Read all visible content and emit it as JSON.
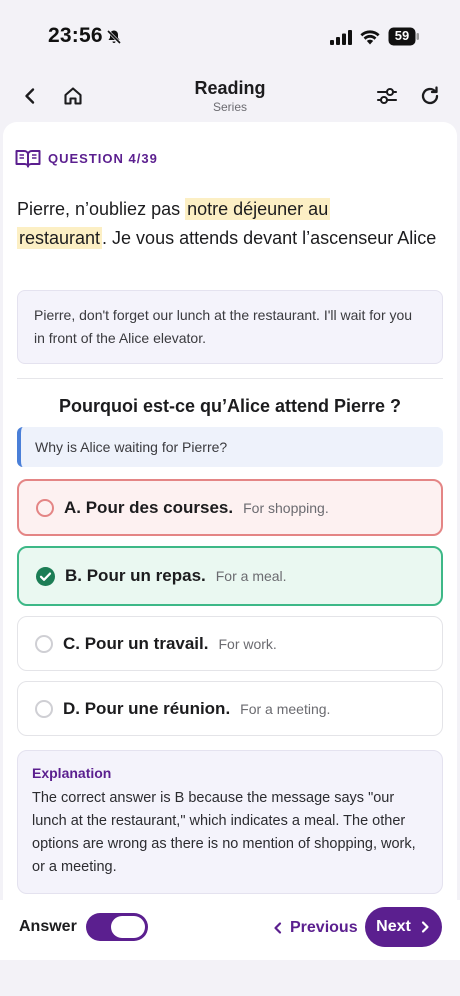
{
  "status": {
    "time": "23:56",
    "battery": "59"
  },
  "header": {
    "title": "Reading",
    "subtitle": "Series"
  },
  "question_badge": {
    "label": "QUESTION 4/39"
  },
  "passage": {
    "before": "Pierre, n’oubliez pas ",
    "highlight_1": "notre déjeuner au",
    "highlight_2": "restaurant",
    "after": ". Je vous attends devant l’ascenseur Alice"
  },
  "passage_translation": "Pierre, don't forget our lunch at the restaurant. I'll wait for you in front of the Alice elevator.",
  "question": {
    "text": "Pourquoi est-ce qu’Alice attend Pierre ?",
    "translation": "Why is Alice waiting for Pierre?"
  },
  "options": [
    {
      "label": "A. Pour des courses.",
      "translation": "For shopping.",
      "state": "wrong"
    },
    {
      "label": "B. Pour un repas.",
      "translation": "For a meal.",
      "state": "correct"
    },
    {
      "label": "C. Pour un travail.",
      "translation": "For work.",
      "state": "neutral"
    },
    {
      "label": "D. Pour une réunion.",
      "translation": "For a meeting.",
      "state": "neutral"
    }
  ],
  "explanation": {
    "title": "Explanation",
    "body": "The correct answer is B because the message says \"our lunch at the restaurant,\" which indicates a meal. The other options are wrong as there is no mention of shopping, work, or a meeting."
  },
  "footer": {
    "answer_label": "Answer",
    "answer_toggle_on": true,
    "previous_label": "Previous",
    "next_label": "Next"
  },
  "colors": {
    "accent": "#5b1f8f",
    "correct": "#3db887",
    "wrong": "#e48585",
    "highlight": "#fcefc4"
  }
}
